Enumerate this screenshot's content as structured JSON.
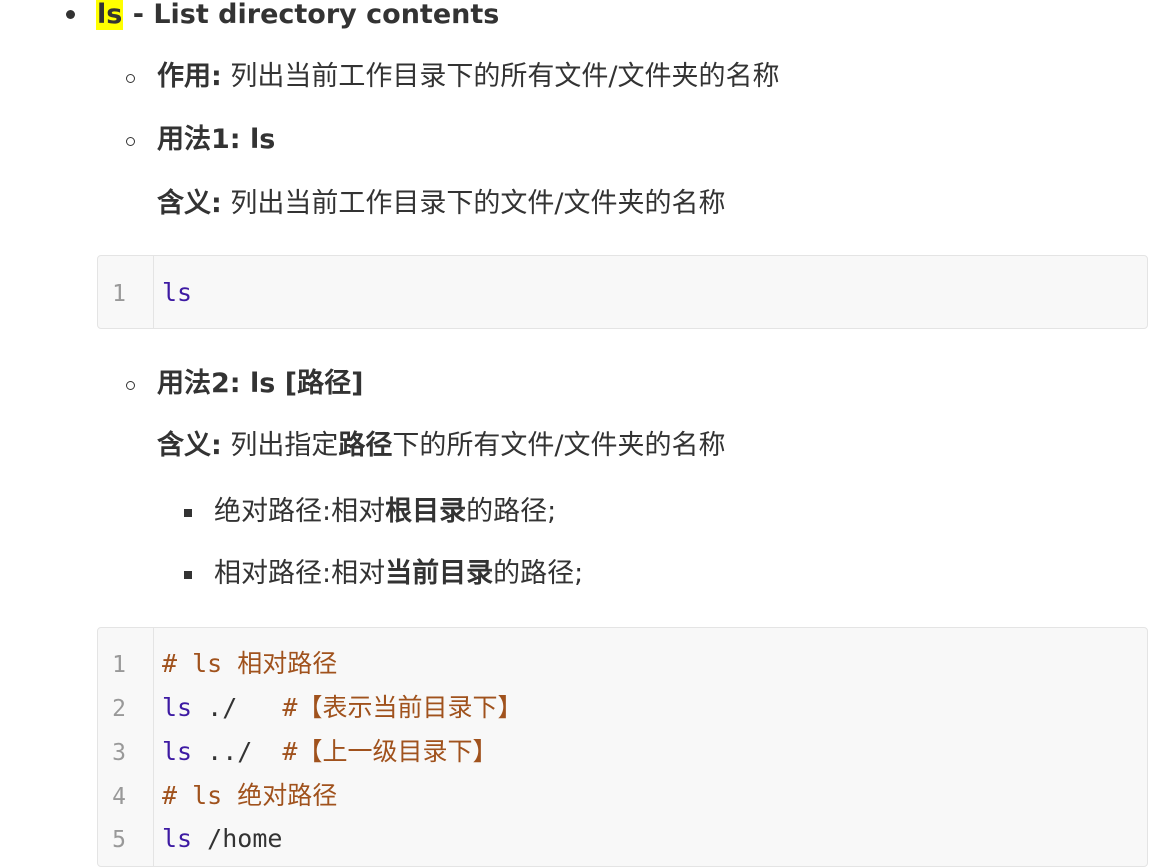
{
  "heading": {
    "command": "ls",
    "rest": " - List directory contents"
  },
  "purpose": {
    "label": "作用:",
    "text": "列出当前工作目录下的所有文件/文件夹的名称"
  },
  "usage1": {
    "label": "用法1:",
    "command": "ls",
    "meaning_label": "含义:",
    "meaning_text": "列出当前工作目录下的文件/文件夹的名称",
    "code_lines": [
      {
        "num": "1",
        "cmd": "ls",
        "arg": "",
        "comment": ""
      }
    ]
  },
  "usage2": {
    "label": "用法2:",
    "command": "ls [路径]",
    "meaning_label": "含义:",
    "meaning_pre": "列出指定",
    "meaning_bold": "路径",
    "meaning_post": "下的所有文件/文件夹的名称",
    "subitems": [
      {
        "pre": "绝对路径:相对",
        "bold": "根目录",
        "post": "的路径;"
      },
      {
        "pre": "相对路径:相对",
        "bold": "当前目录",
        "post": "的路径;"
      }
    ],
    "code_lines": [
      {
        "num": "1",
        "comment": "# ls 相对路径"
      },
      {
        "num": "2",
        "cmd": "ls",
        "arg": " ./   ",
        "comment": "#【表示当前目录下】"
      },
      {
        "num": "3",
        "cmd": "ls",
        "arg": " ../  ",
        "comment": "#【上一级目录下】"
      },
      {
        "num": "4",
        "comment": "# ls 绝对路径"
      },
      {
        "num": "5",
        "cmd": "ls",
        "arg": " /home",
        "comment": ""
      }
    ]
  }
}
